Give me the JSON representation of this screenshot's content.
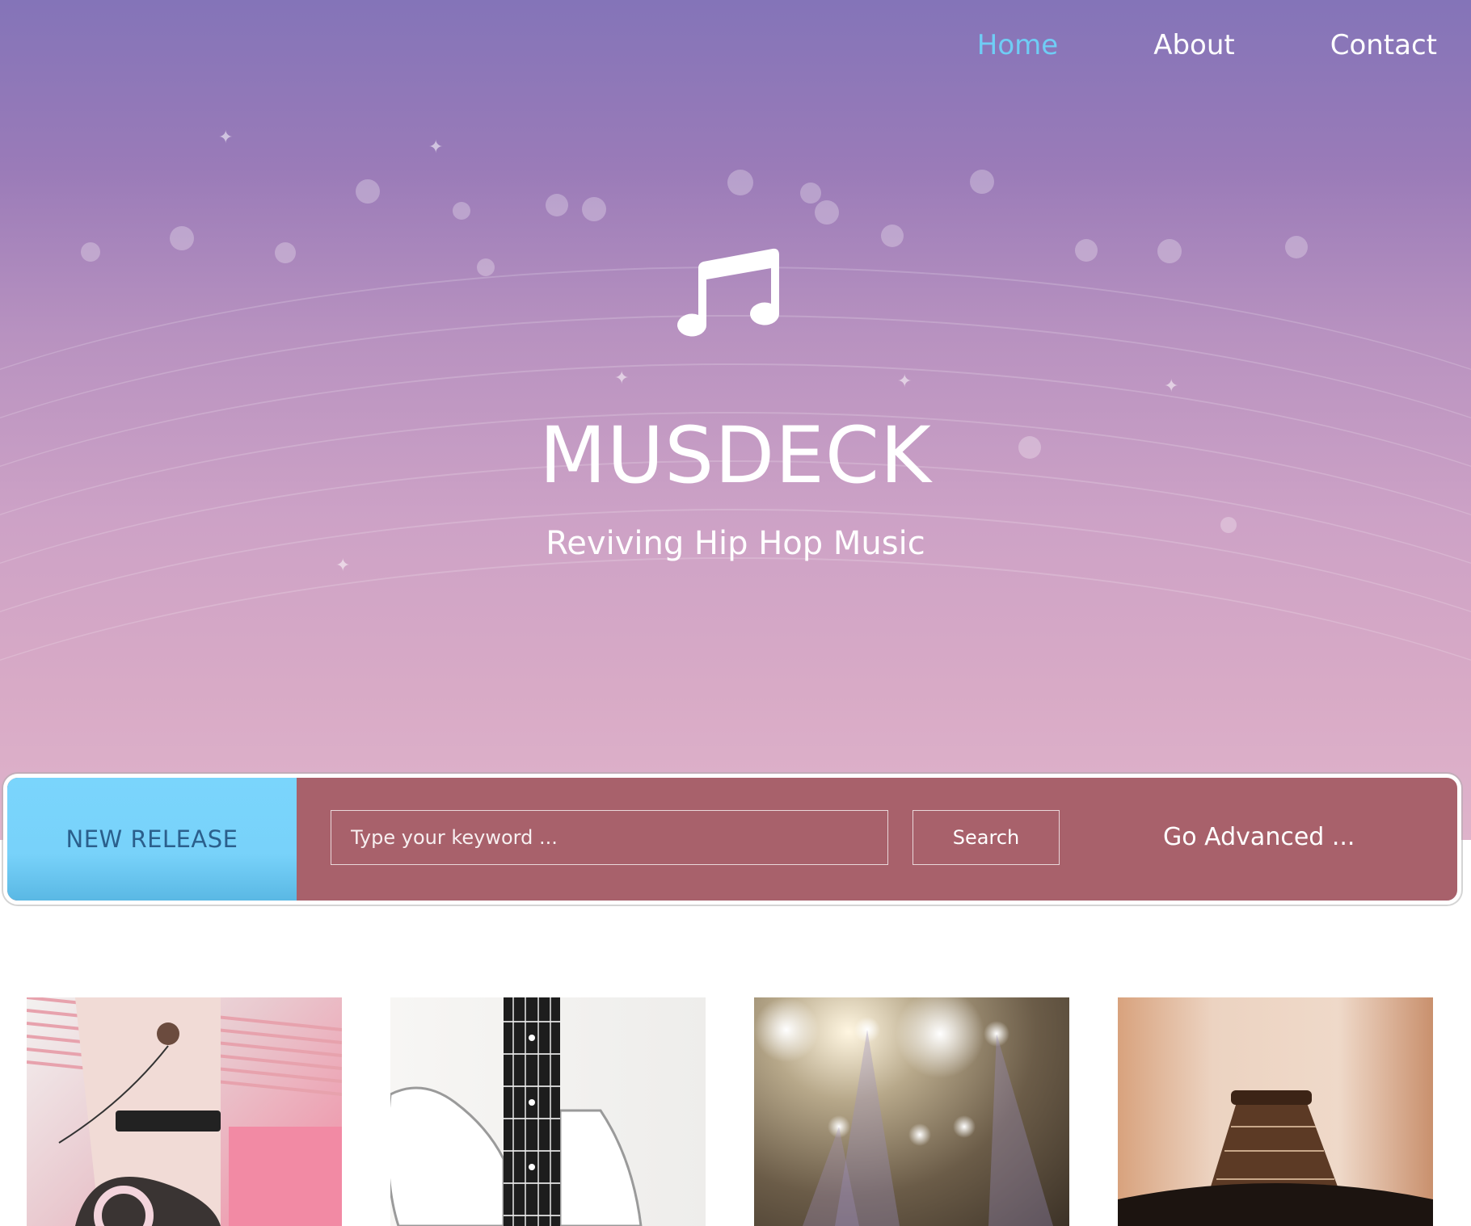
{
  "nav": {
    "items": [
      {
        "label": "Home",
        "active": true
      },
      {
        "label": "About",
        "active": false
      },
      {
        "label": "Contact",
        "active": false
      }
    ]
  },
  "hero": {
    "icon": "music-note-icon",
    "title": "MUSDECK",
    "tagline": "Reviving Hip Hop Music"
  },
  "searchbar": {
    "tab_label": "NEW RELEASE",
    "input_placeholder": "Type your keyword ...",
    "input_value": "",
    "search_label": "Search",
    "advanced_label": "Go Advanced ..."
  },
  "colors": {
    "nav_active": "#6fcdf5",
    "new_release_bg": "#7ad5fc",
    "new_release_text": "#2b5f8c",
    "searchbar_bg": "#a8616b"
  },
  "thumbnails": [
    {
      "subject": "woman-with-headphones-image"
    },
    {
      "subject": "white-bass-guitar-image"
    },
    {
      "subject": "stage-lights-image"
    },
    {
      "subject": "guitar-neck-image"
    }
  ]
}
